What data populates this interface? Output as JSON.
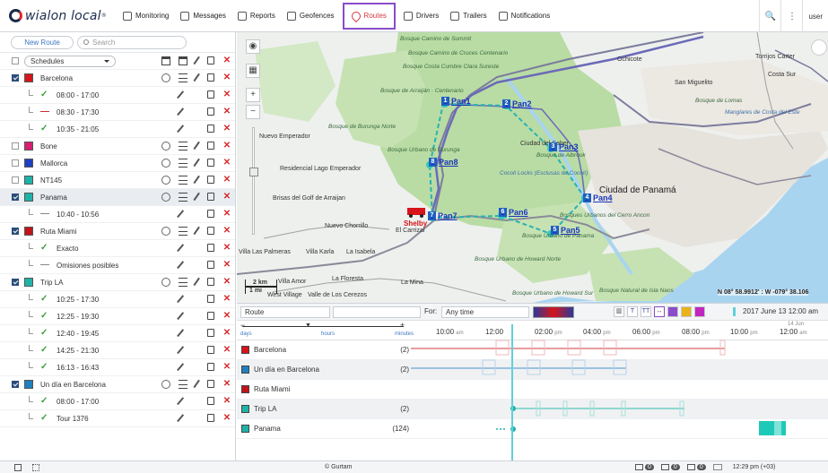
{
  "logo": {
    "text": "wialon local",
    "reg": "®"
  },
  "nav": [
    {
      "label": "Monitoring",
      "icon": "globe-icon"
    },
    {
      "label": "Messages",
      "icon": "messages-icon"
    },
    {
      "label": "Reports",
      "icon": "reports-icon"
    },
    {
      "label": "Geofences",
      "icon": "geofence-icon"
    },
    {
      "label": "Routes",
      "icon": "routes-icon"
    },
    {
      "label": "Drivers",
      "icon": "driver-icon"
    },
    {
      "label": "Trailers",
      "icon": "trailer-icon"
    },
    {
      "label": "Notifications",
      "icon": "notification-icon"
    }
  ],
  "topright": {
    "search": "🔍",
    "menu": "⋮",
    "user": "user"
  },
  "left": {
    "new_route": "New Route",
    "search_placeholder": "Search",
    "schedules": "Schedules"
  },
  "routes": [
    {
      "kind": "route",
      "name": "Barcelona",
      "color": "#d7141a",
      "checked": true,
      "selected": false
    },
    {
      "kind": "sub",
      "mark": "ok",
      "name": "08:00 - 17:00"
    },
    {
      "kind": "sub",
      "mark": "no",
      "name": "08:30 - 17:30"
    },
    {
      "kind": "sub",
      "mark": "ok",
      "name": "10:35 - 21:05"
    },
    {
      "kind": "route",
      "name": "Bone",
      "color": "#d81e70",
      "checked": false,
      "selected": false
    },
    {
      "kind": "route",
      "name": "Mallorca",
      "color": "#1f3fbf",
      "checked": false,
      "selected": false
    },
    {
      "kind": "route",
      "name": "NT145",
      "color": "#1fb3a8",
      "checked": false,
      "selected": false
    },
    {
      "kind": "route",
      "name": "Panama",
      "color": "#1fb3a8",
      "checked": true,
      "selected": true
    },
    {
      "kind": "sub",
      "mark": "ds",
      "name": "10:40 - 10:56"
    },
    {
      "kind": "route",
      "name": "Ruta Miami",
      "color": "#c0141a",
      "checked": true,
      "selected": false
    },
    {
      "kind": "sub",
      "mark": "ok",
      "name": "Exacto"
    },
    {
      "kind": "sub",
      "mark": "ds",
      "name": "Omisiones posibles"
    },
    {
      "kind": "route",
      "name": "Trip LA",
      "color": "#1fb3a8",
      "checked": true,
      "selected": false
    },
    {
      "kind": "sub",
      "mark": "ok",
      "name": "10:25 - 17:30"
    },
    {
      "kind": "sub",
      "mark": "ok",
      "name": "12:25 - 19:30"
    },
    {
      "kind": "sub",
      "mark": "ok",
      "name": "12:40 - 19:45"
    },
    {
      "kind": "sub",
      "mark": "ok",
      "name": "14:25 - 21:30"
    },
    {
      "kind": "sub",
      "mark": "ok",
      "name": "16:13 - 16:43"
    },
    {
      "kind": "route",
      "name": "Un día en Barcelona",
      "color": "#1f7fbf",
      "checked": true,
      "selected": false
    },
    {
      "kind": "sub",
      "mark": "ok",
      "name": "08:00 - 17:00"
    },
    {
      "kind": "sub",
      "mark": "ok",
      "name": "Tour 1376"
    }
  ],
  "map": {
    "labels": {
      "bosque_cam_summit": "Bosque Camino de Summit",
      "bosque_camino_cruces": "Bosque Camino de Cruces Centenario",
      "bosque_costa_cumbre": "Bosque Costa Cumbre Clara Sureste",
      "bosque_arrajan": "Bosque de Arraiján · Centenario",
      "bosque_burunga": "Bosque de Burunga Norte",
      "nuevo_emperador": "Nuevo Emperador",
      "residencial": "Residencial Lago Emperador",
      "brisas": "Brisas del Golf de Arraijan",
      "nuevo_chorrillo": "Nuevo Chorrillo",
      "villa_palmeras": "Villa Las Palmeras",
      "villa_karla": "Villa Karla",
      "la_isabela": "La Isabela",
      "villa_amor": "Villa Amor",
      "la_floresta": "La Floresta",
      "west_village": "West Village",
      "valle_cerezos": "Valle de Los Cerezos",
      "la_mina": "La Mina",
      "el_carrizal": "El Carrizal",
      "shelby": "Shelby",
      "bosque_urbano_burunga": "Bosque Urbano de Burunga",
      "ciudad_saber": "Ciudad del Saber",
      "bosque_albrook": "Bosque de Albrook",
      "cocoli": "Cocoli Locks (Esclusas de Cocolí)",
      "ciudad_panama": "Ciudad de Panamá",
      "bosque_cerro": "Bosques Urbanos del Cerro Ancon",
      "bosque_howard": "Bosque Urbano de Howard Norte",
      "bosque_howard_sur": "Bosque Urbano de Howard Sur",
      "bosque_isla": "Bosque Natural de Isla Naos",
      "bosque_pan": "Bosque Urbano de Panama",
      "san_miguelito": "San Miguelito",
      "manglares": "Manglares de Costa del Este",
      "lomas": "Bosque de Lomas",
      "ochicote": "Ochicote",
      "torrijos": "Torrijos Carter",
      "costa_sur": "Costa Sur"
    },
    "points": [
      {
        "num": "1",
        "label": "Pan1"
      },
      {
        "num": "2",
        "label": "Pan2"
      },
      {
        "num": "3",
        "label": "Pan3"
      },
      {
        "num": "4",
        "label": "Pan4"
      },
      {
        "num": "5",
        "label": "Pan5"
      },
      {
        "num": "6",
        "label": "Pan6"
      },
      {
        "num": "7",
        "label": "Pan7"
      },
      {
        "num": "8",
        "label": "Pan8"
      }
    ],
    "coords": "N 08° 58.9912' : W -079° 38.106",
    "scale_km": "2 km",
    "scale_mi": "1 mi"
  },
  "timeline": {
    "route_select": "Route",
    "for_label": "For:",
    "period": "Any time",
    "date_time": "2017 June 13 12:00 am",
    "scale_days": "days",
    "scale_hours": "hours",
    "scale_minutes": "minutes",
    "ticks": [
      {
        "t": "10:00",
        "ap": "am"
      },
      {
        "t": "12:00",
        "ap": ""
      },
      {
        "t": "02:00",
        "ap": "pm"
      },
      {
        "t": "04:00",
        "ap": "pm"
      },
      {
        "t": "06:00",
        "ap": "pm"
      },
      {
        "t": "08:00",
        "ap": "pm"
      },
      {
        "t": "10:00",
        "ap": "pm"
      },
      {
        "t": "12:00",
        "ap": "am"
      }
    ],
    "next_day": "14 Jun",
    "rows": [
      {
        "name": "Barcelona",
        "count": "(2)",
        "color": "#d7141a"
      },
      {
        "name": "Un día en Barcelona",
        "count": "(2)",
        "color": "#1f7fbf"
      },
      {
        "name": "Ruta Miami",
        "count": "",
        "color": "#c0141a"
      },
      {
        "name": "Trip LA",
        "count": "(2)",
        "color": "#1fb3a8"
      },
      {
        "name": "Panama",
        "count": "(124)",
        "color": "#1fb3a8"
      }
    ]
  },
  "footer": {
    "copyright": "© Gurtam",
    "badge1": "0",
    "badge2": "0",
    "badge3": "0",
    "time": "12:29 pm (+03)"
  }
}
